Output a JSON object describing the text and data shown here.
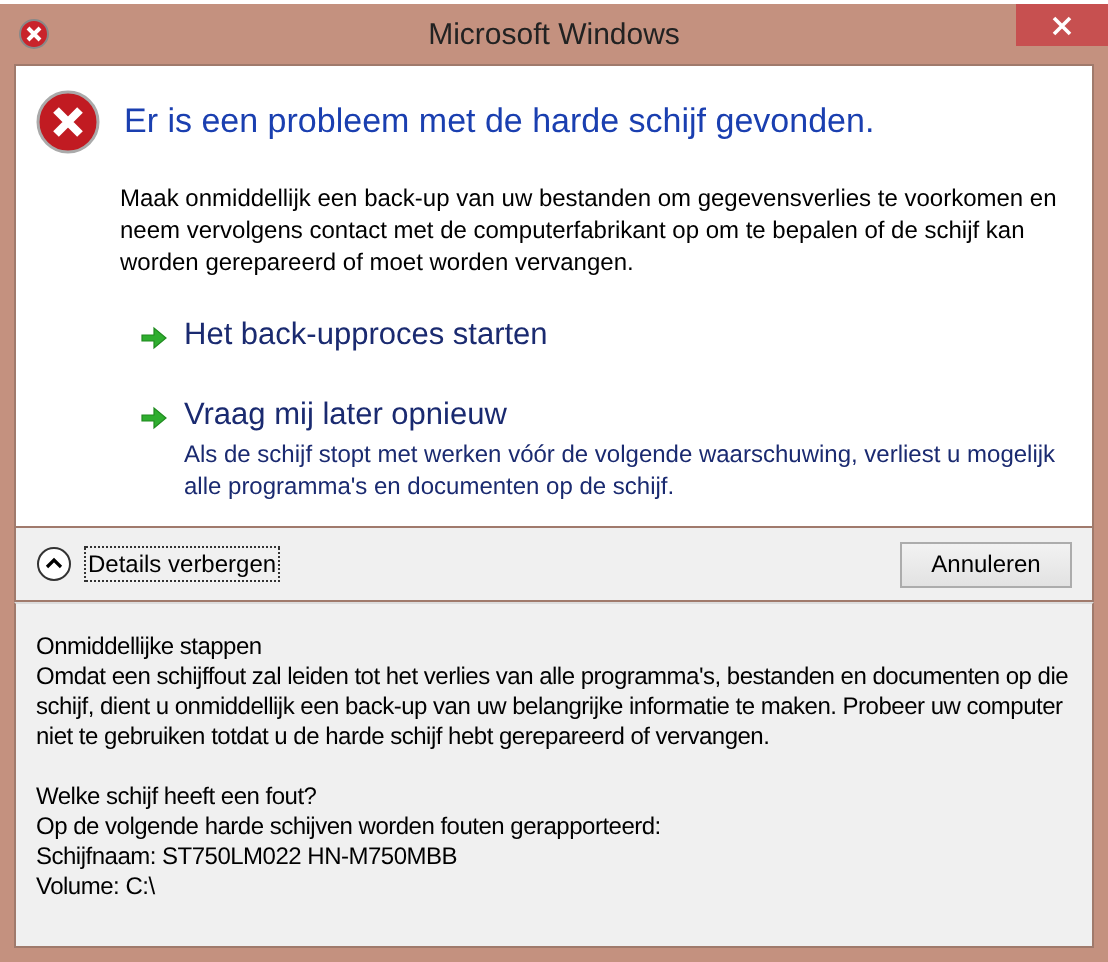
{
  "window": {
    "title": "Microsoft Windows"
  },
  "heading": "Er is een probleem met de harde schijf gevonden.",
  "message": "Maak onmiddellijk een back-up van uw bestanden om gegevensverlies te voorkomen en neem vervolgens contact met de computerfabrikant op om te bepalen of de schijf kan worden gerepareerd of moet worden vervangen.",
  "commands": [
    {
      "label": "Het back-upproces starten"
    },
    {
      "label": "Vraag mij later opnieuw",
      "note": "Als de schijf stopt met werken vóór de volgende waarschuwing, verliest u mogelijk alle programma's en documenten op de schijf."
    }
  ],
  "details_toggle": {
    "label": "Details verbergen",
    "expanded": true
  },
  "buttons": [
    "Annuleren"
  ],
  "details": [
    {
      "title": "Onmiddellijke stappen",
      "lines": [
        "Omdat een schijffout zal leiden tot het verlies van alle programma's, bestanden en documenten op die schijf, dient u onmiddellijk een back-up van uw belangrijke informatie te maken. Probeer uw computer niet te gebruiken totdat u de harde schijf hebt gerepareerd of vervangen."
      ]
    },
    {
      "title": "Welke schijf heeft een fout?",
      "lines": [
        "Op de volgende harde schijven worden fouten gerapporteerd:",
        "Schijfnaam: ST750LM022 HN-M750MBB",
        "Volume: C:\\"
      ]
    }
  ]
}
